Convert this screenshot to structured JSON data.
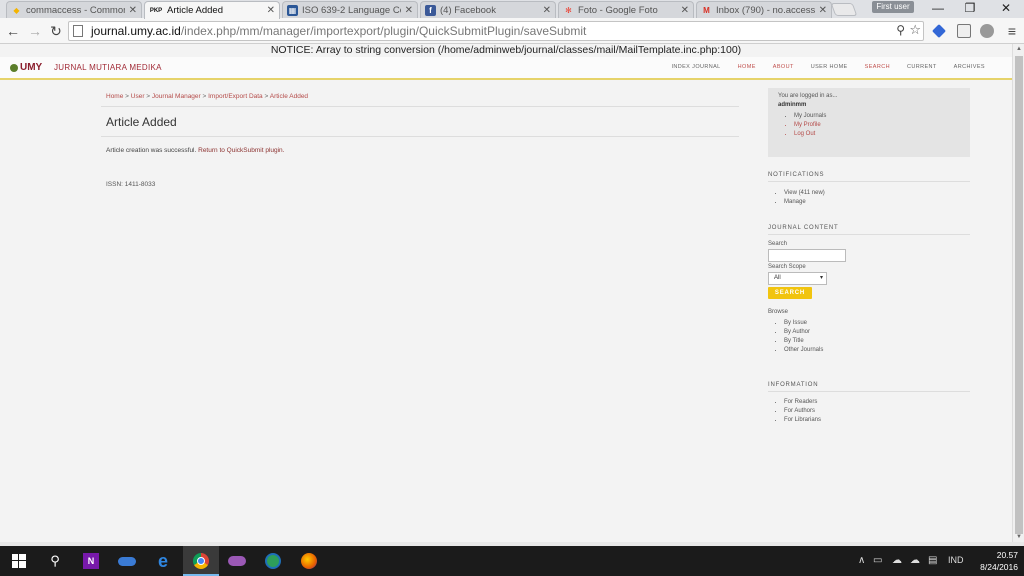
{
  "browser": {
    "tabs": [
      {
        "title": "commaccess - Common",
        "icon": "drive-icon",
        "color": "#f4b400",
        "active": false
      },
      {
        "title": "Article Added",
        "icon": "pkp-icon",
        "color": "#333333",
        "active": true,
        "icon_text": "PKP"
      },
      {
        "title": "ISO 639-2 Language Co",
        "icon": "loc-icon",
        "color": "#2b5797",
        "active": false
      },
      {
        "title": "(4) Facebook",
        "icon": "facebook-icon",
        "color": "#3b5998",
        "active": false
      },
      {
        "title": "Foto - Google Foto",
        "icon": "photos-icon",
        "color": "#ea4335",
        "active": false
      },
      {
        "title": "Inbox (790) - no.access",
        "icon": "gmail-icon",
        "color": "#d93025",
        "active": false
      }
    ],
    "profile": "First user",
    "url_host": "journal.umy.ac.id",
    "url_path": "/index.php/mm/manager/importexport/plugin/QuickSubmitPlugin/saveSubmit"
  },
  "notice": "NOTICE: Array to string conversion (/home/adminweb/journal/classes/mail/MailTemplate.inc.php:100)",
  "header": {
    "logo_text": "UMY",
    "journal_title": "JURNAL MUTIARA MEDIKA",
    "nav": [
      "INDEX JOURNAL",
      "HOME",
      "ABOUT",
      "USER HOME",
      "SEARCH",
      "CURRENT",
      "ARCHIVES"
    ]
  },
  "breadcrumb": {
    "items": [
      "Home",
      "User",
      "Journal Manager",
      "Import/Export Data",
      "Article Added"
    ],
    "sep": " > "
  },
  "page": {
    "title": "Article Added",
    "message": "Article creation was successful.",
    "return_link": "Return to QuickSubmit plugin.",
    "issn": "ISSN: 1411-8033"
  },
  "sidebar": {
    "logged_in_label": "You are logged in as...",
    "username": "adminmm",
    "user_links": [
      "My Journals",
      "My Profile",
      "Log Out"
    ],
    "notifications_heading": "NOTIFICATIONS",
    "notification_links": [
      "View (411 new)",
      "Manage"
    ],
    "journal_content_heading": "JOURNAL CONTENT",
    "search_label": "Search",
    "search_value": "",
    "scope_label": "Search Scope",
    "scope_value": "All",
    "search_button": "SEARCH",
    "browse_label": "Browse",
    "browse_links": [
      "By Issue",
      "By Author",
      "By Title",
      "Other Journals"
    ],
    "information_heading": "INFORMATION",
    "information_links": [
      "For Readers",
      "For Authors",
      "For Librarians"
    ]
  },
  "taskbar": {
    "lang": "IND",
    "time": "20.57",
    "date": "8/24/2016"
  }
}
